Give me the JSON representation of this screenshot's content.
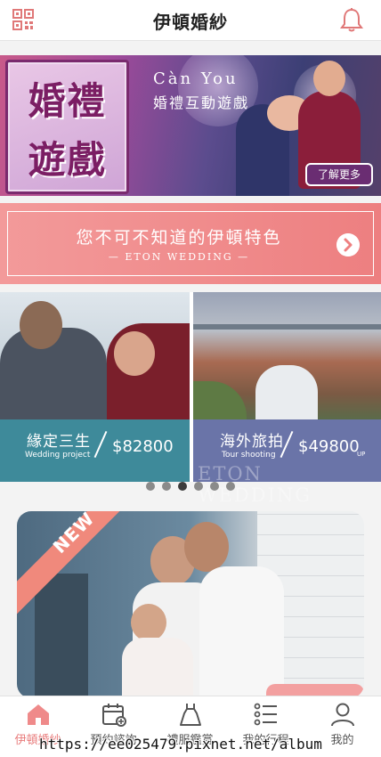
{
  "header": {
    "title": "伊頓婚紗",
    "qr_icon": "qr-code-icon",
    "bell_icon": "bell-icon"
  },
  "hero": {
    "box_line1": "婚禮",
    "box_line2": "遊戲",
    "brand": "Càn You",
    "subtitle": "婚禮互動遊戲",
    "more_label": "了解更多"
  },
  "feature": {
    "title": "您不可不知道的伊頓特色",
    "subtitle": "— ETON WEDDING —",
    "arrow_icon": "chevron-right-icon"
  },
  "cards": [
    {
      "title": "緣定三生",
      "subtitle": "Wedding project",
      "price": "$82800",
      "suffix": ""
    },
    {
      "title": "海外旅拍",
      "subtitle": "Tour shooting",
      "price": "$49800",
      "suffix": "UP"
    }
  ],
  "watermark": "ETON WEDDING",
  "carousel": {
    "count": 6,
    "active": 2
  },
  "new_badge": "NEW",
  "nav": [
    {
      "label": "伊頓婚紗",
      "icon": "home-icon",
      "active": true
    },
    {
      "label": "預約諮詢",
      "icon": "calendar-add-icon",
      "active": false
    },
    {
      "label": "禮服鑑賞",
      "icon": "dress-icon",
      "active": false
    },
    {
      "label": "我的行程",
      "icon": "list-icon",
      "active": false
    },
    {
      "label": "我的",
      "icon": "user-icon",
      "active": false
    }
  ],
  "overlay_url": "https://ee025479.pixnet.net/album",
  "colors": {
    "accent": "#e87a7a",
    "feature": "#ee8586",
    "card_left": "#3e8a9a",
    "card_right": "#6a74a8"
  }
}
